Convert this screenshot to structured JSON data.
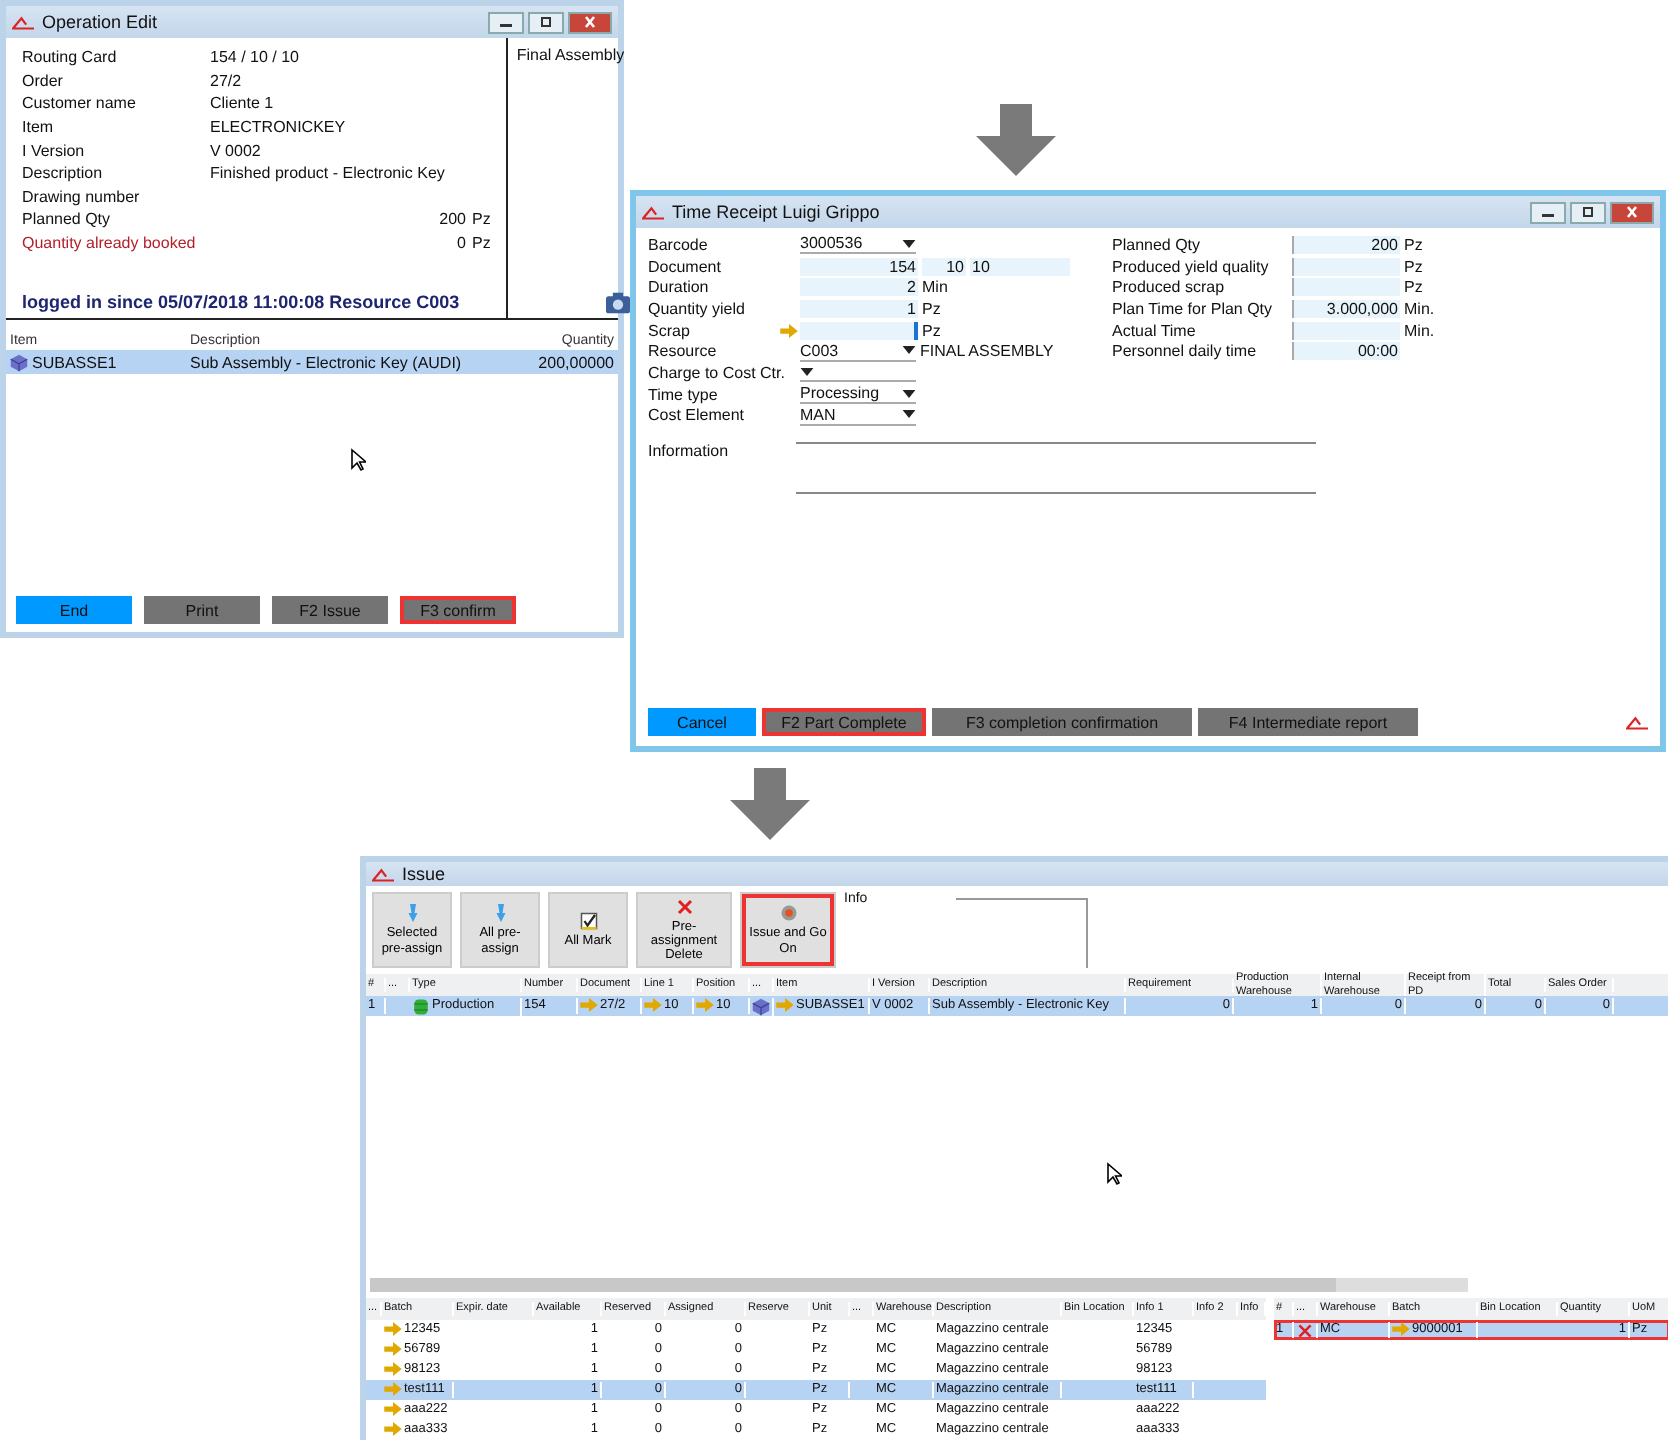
{
  "operation_edit": {
    "title": "Operation Edit",
    "fields": [
      {
        "label": "Routing Card",
        "value": "154 / 10 / 10",
        "alert": false
      },
      {
        "label": "Order",
        "value": "27/2",
        "alert": false
      },
      {
        "label": "Customer name",
        "value": "Cliente 1",
        "alert": false
      },
      {
        "label": "Item",
        "value": "ELECTRONICKEY",
        "alert": false
      },
      {
        "label": "I Version",
        "value": "V 0002",
        "alert": false
      },
      {
        "label": "Description",
        "value": "Finished product - Electronic Key",
        "alert": false
      },
      {
        "label": "Drawing number",
        "alert": false
      },
      {
        "label": "Planned Qty",
        "amount": "200",
        "unit": "Pz",
        "alert": false
      },
      {
        "label": "Quantity already booked",
        "amount": "0",
        "unit": "Pz",
        "alert": true
      }
    ],
    "side_title": "Final Assembly",
    "status": "logged in since  05/07/2018 11:00:08 Resource C003",
    "columns": [
      "Item",
      "Description",
      "Quantity"
    ],
    "rows": [
      {
        "cells": [
          "SUBASSE1",
          "Sub Assembly - Electronic Key (AUDI)",
          "200,00000"
        ],
        "selected": true
      }
    ],
    "buttons": [
      {
        "label": "End",
        "kind": "primary",
        "highlighted": false
      },
      {
        "label": "Print",
        "kind": "secondary",
        "highlighted": false
      },
      {
        "label": "F2 Issue",
        "kind": "secondary",
        "highlighted": false
      },
      {
        "label": "F3 confirm",
        "kind": "secondary",
        "highlighted": true
      }
    ]
  },
  "time_receipt": {
    "title": "Time Receipt Luigi Grippo",
    "left_fields": [
      {
        "label": "Barcode",
        "kind": "dropdown",
        "value": "3000536"
      },
      {
        "label": "Document",
        "kind": "document",
        "values": [
          "154",
          "10",
          "10"
        ]
      },
      {
        "label": "Duration",
        "kind": "number",
        "value": "2",
        "unit": "Min"
      },
      {
        "label": "Quantity yield",
        "kind": "number",
        "value": "1",
        "unit": "Pz"
      },
      {
        "label": "Scrap",
        "kind": "number",
        "pointer": true,
        "unit": "Pz"
      },
      {
        "label": "Resource",
        "kind": "dropdown",
        "value": "C003",
        "extra": "FINAL ASSEMBLY"
      },
      {
        "label": "Charge to Cost Ctr.",
        "kind": "dropdown"
      },
      {
        "label": "Time type",
        "kind": "dropdown",
        "value": "Processing"
      },
      {
        "label": "Cost Element",
        "kind": "dropdown",
        "value": "MAN"
      }
    ],
    "right_fields": [
      {
        "label": "Planned Qty",
        "value": "200",
        "unit": "Pz"
      },
      {
        "label": "Produced yield quality",
        "unit": "Pz"
      },
      {
        "label": "Produced scrap",
        "unit": "Pz"
      },
      {
        "label": "Plan Time for Plan Qty",
        "value": "3.000,000",
        "unit": "Min."
      },
      {
        "label": "Actual Time",
        "unit": "Min."
      },
      {
        "label": "Personnel daily time",
        "value": "00:00"
      }
    ],
    "info_label": "Information",
    "buttons": [
      {
        "label": "Cancel",
        "kind": "primary",
        "highlighted": false
      },
      {
        "label": "F2 Part Complete",
        "kind": "secondary",
        "highlighted": true
      },
      {
        "label": "F3 completion confirmation",
        "kind": "secondary",
        "highlighted": false
      },
      {
        "label": "F4 Intermediate report",
        "kind": "secondary",
        "highlighted": false
      }
    ]
  },
  "issue": {
    "title": "Issue",
    "toolbar": [
      {
        "label": "Selected pre-assign",
        "highlighted": false
      },
      {
        "label": "All pre-assign",
        "highlighted": false
      },
      {
        "label": "All Mark",
        "highlighted": false
      },
      {
        "label": "Pre-assignment Delete",
        "highlighted": false
      },
      {
        "label": "Issue and Go On",
        "highlighted": true
      }
    ],
    "info_label": "Info",
    "columns": [
      {
        "label": "#"
      },
      {
        "label": "..."
      },
      {
        "label": "Type"
      },
      {
        "label": "Number"
      },
      {
        "label": "Document"
      },
      {
        "label": "Line 1"
      },
      {
        "label": "Position"
      },
      {
        "label": "..."
      },
      {
        "label": "Item"
      },
      {
        "label": "I Version"
      },
      {
        "label": "Description"
      },
      {
        "label": "Requirement"
      },
      {
        "label": "Production Warehouse"
      },
      {
        "label": "Internal Warehouse"
      },
      {
        "label": "Receipt from PD"
      },
      {
        "label": "Total"
      },
      {
        "label": "Sales Order"
      }
    ],
    "rows": [
      {
        "selected": true,
        "cells": [
          "1",
          "",
          "Production",
          "154",
          "27/2",
          "10",
          "10",
          "",
          "SUBASSE1",
          "V 0002",
          "Sub Assembly - Electronic Key",
          "0",
          "1",
          "0",
          "0",
          "0",
          "0"
        ]
      }
    ],
    "batch_columns": [
      "...",
      "Batch",
      "Expir. date",
      "Available",
      "Reserved",
      "Assigned",
      "Reserve",
      "Unit",
      "...",
      "Warehouse",
      "Description",
      "Bin Location",
      "Info 1",
      "Info 2",
      "Info"
    ],
    "batch_rows": [
      {
        "selected": false,
        "cells": [
          "",
          "12345",
          "",
          "1",
          "0",
          "0",
          "",
          "Pz",
          "",
          "MC",
          "Magazzino centrale",
          "",
          "12345",
          "",
          ""
        ]
      },
      {
        "selected": false,
        "cells": [
          "",
          "56789",
          "",
          "1",
          "0",
          "0",
          "",
          "Pz",
          "",
          "MC",
          "Magazzino centrale",
          "",
          "56789",
          "",
          ""
        ]
      },
      {
        "selected": false,
        "cells": [
          "",
          "98123",
          "",
          "1",
          "0",
          "0",
          "",
          "Pz",
          "",
          "MC",
          "Magazzino centrale",
          "",
          "98123",
          "",
          ""
        ]
      },
      {
        "selected": true,
        "cells": [
          "",
          "test111",
          "",
          "1",
          "0",
          "0",
          "",
          "Pz",
          "",
          "MC",
          "Magazzino centrale",
          "",
          "test111",
          "",
          ""
        ]
      },
      {
        "selected": false,
        "cells": [
          "",
          "aaa222",
          "",
          "1",
          "0",
          "0",
          "",
          "Pz",
          "",
          "MC",
          "Magazzino centrale",
          "",
          "aaa222",
          "",
          ""
        ]
      },
      {
        "selected": false,
        "cells": [
          "",
          "aaa333",
          "",
          "1",
          "0",
          "0",
          "",
          "Pz",
          "",
          "MC",
          "Magazzino centrale",
          "",
          "aaa333",
          "",
          ""
        ]
      }
    ],
    "assigned_columns": [
      "#",
      "...",
      "Warehouse",
      "Batch",
      "Bin Location",
      "Quantity",
      "UoM"
    ],
    "assigned_rows": [
      {
        "selected": true,
        "highlighted": true,
        "cells": [
          "1",
          "",
          "MC",
          "9000001",
          "",
          "1",
          "Pz"
        ]
      }
    ]
  }
}
